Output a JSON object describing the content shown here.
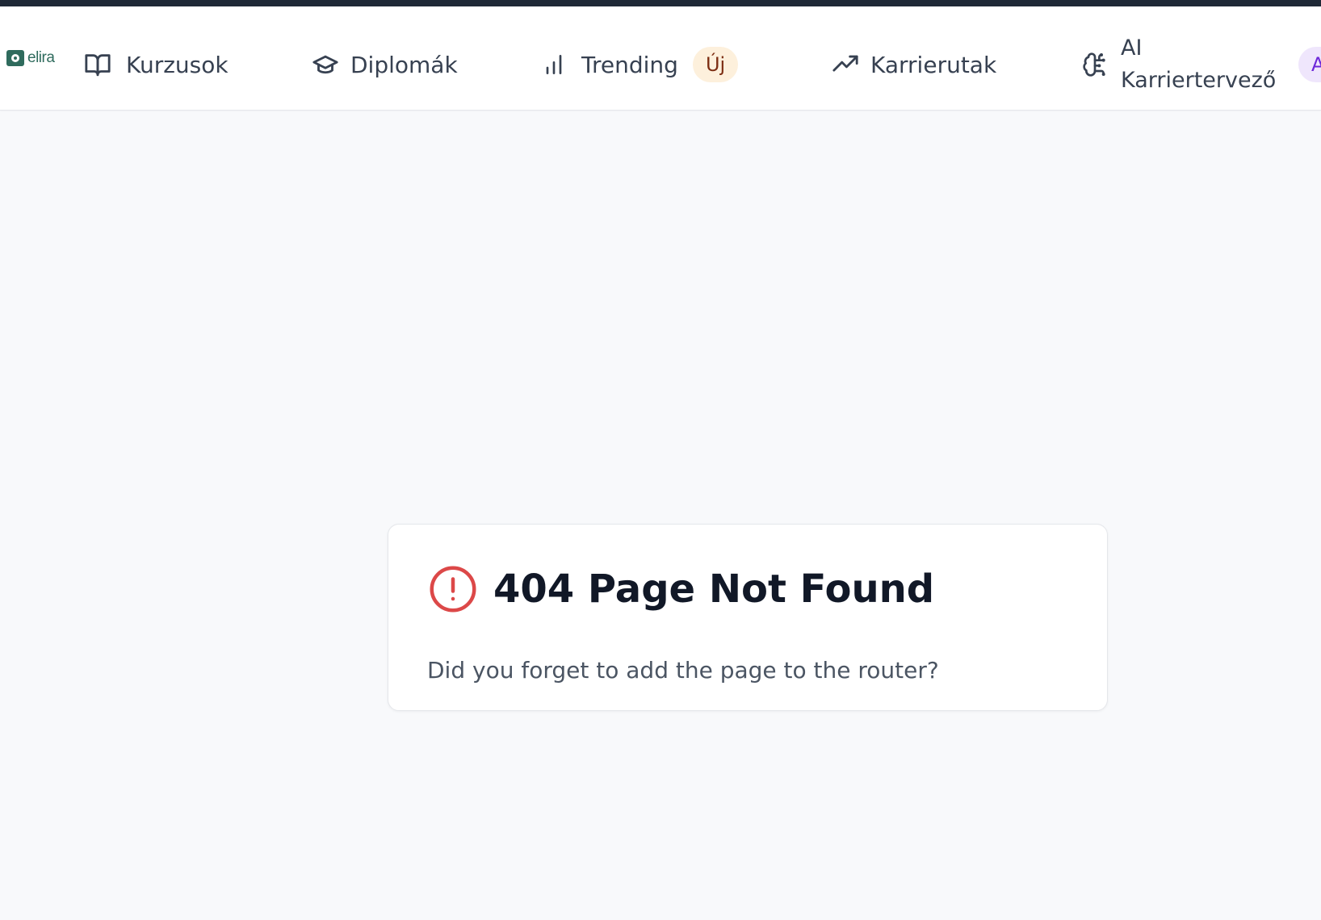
{
  "brand": {
    "name": "elira",
    "color": "#2f6b5d"
  },
  "nav": {
    "items": [
      {
        "label": "Kurzusok",
        "icon": "book-open-icon"
      },
      {
        "label": "Diplomák",
        "icon": "graduation-cap-icon"
      },
      {
        "label": "Trending",
        "icon": "bar-chart-icon",
        "badge": "Új"
      },
      {
        "label": "Karrierutak",
        "icon": "trending-up-icon"
      },
      {
        "label": "AI Karriertervező",
        "icon": "brain-circuit-icon",
        "badge": "AI"
      }
    ]
  },
  "error": {
    "icon": "alert-circle-icon",
    "title": "404 Page Not Found",
    "message": "Did you forget to add the page to the router?",
    "icon_color": "#dc4848"
  },
  "colors": {
    "top_stripe": "#1f2937",
    "background": "#f8f9fb",
    "badge_new_bg": "#fdf0dc",
    "badge_ai_bg": "#efe6fc"
  }
}
